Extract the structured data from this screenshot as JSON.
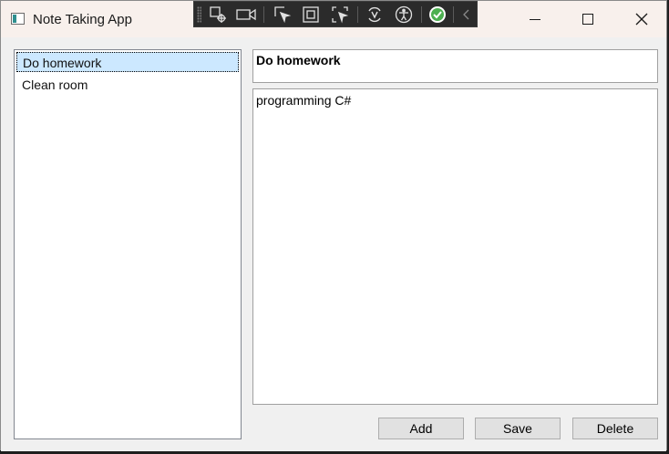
{
  "window": {
    "title": "Note Taking App"
  },
  "toolbar": {
    "icons": [
      "select-element-icon",
      "video-icon",
      "pointer-icon",
      "frame-icon",
      "select-scan-icon",
      "hot-reload-icon",
      "accessibility-icon",
      "check-icon",
      "collapse-icon"
    ]
  },
  "notes": {
    "items": [
      {
        "label": "Do homework",
        "selected": true
      },
      {
        "label": "Clean room",
        "selected": false
      }
    ]
  },
  "editor": {
    "title": "Do homework",
    "body": "programming C#"
  },
  "buttons": {
    "add": "Add",
    "save": "Save",
    "delete": "Delete"
  },
  "colors": {
    "selection": "#cce8ff",
    "titlebar": "#f8f0ec",
    "check_accent": "#4caf50"
  }
}
